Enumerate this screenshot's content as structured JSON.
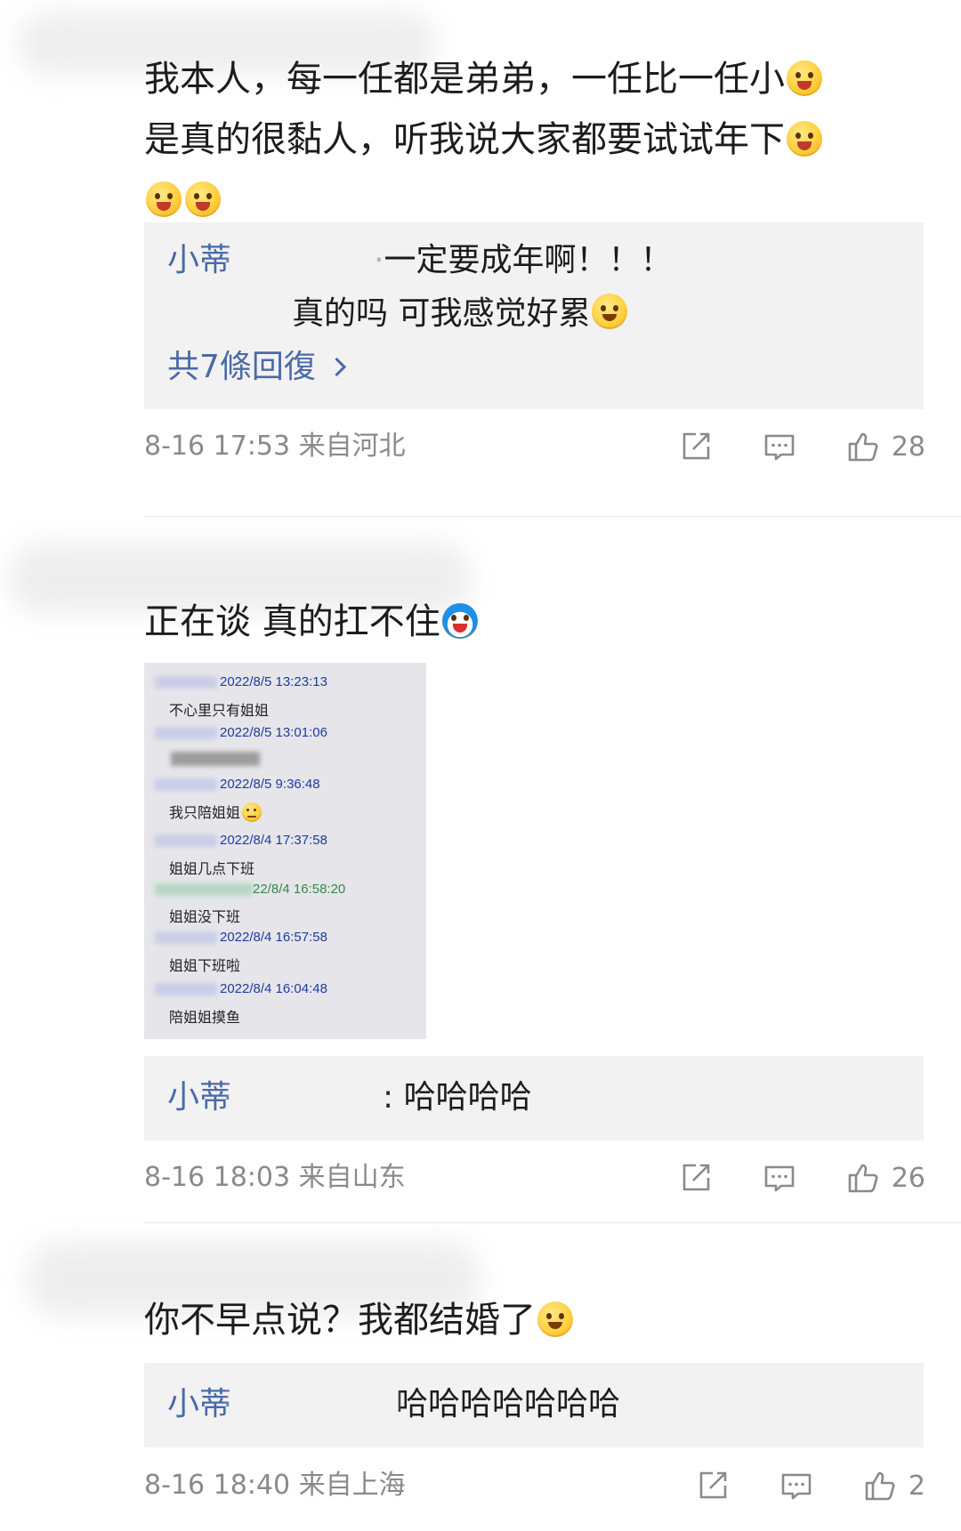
{
  "comments": [
    {
      "text_line1": "我本人，每一任都是弟弟，一任比一任小",
      "text_line2": "是真的很黏人，听我说大家都要试试年下",
      "replies": [
        {
          "author": "小蒂",
          "separator": "·",
          "text": "一定要成年啊！！！"
        },
        {
          "author": "",
          "text": "真的吗 可我感觉好累"
        }
      ],
      "more_replies": "共7條回復",
      "time": "8-16 17:53",
      "location": "来自河北",
      "likes": "28"
    },
    {
      "text": "正在谈 真的扛不住",
      "screenshot": {
        "messages": [
          {
            "time": "2022/8/5 13:23:13",
            "text": "不心里只有姐姐"
          },
          {
            "time": "2022/8/5 13:01:06",
            "text": ""
          },
          {
            "time": "2022/8/5 9:36:48",
            "text": "我只陪姐姐"
          },
          {
            "time": "2022/8/4 17:37:58",
            "text": "姐姐几点下班"
          },
          {
            "time": "22/8/4 16:58:20",
            "text": "姐姐没下班"
          },
          {
            "time": "2022/8/4 16:57:58",
            "text": "姐姐下班啦"
          },
          {
            "time": "2022/8/4 16:04:48",
            "text": "陪姐姐摸鱼"
          }
        ]
      },
      "replies": [
        {
          "author": "小蒂",
          "text": ": 哈哈哈哈"
        }
      ],
      "time": "8-16 18:03",
      "location": "来自山东",
      "likes": "26"
    },
    {
      "text": "你不早点说？我都结婚了",
      "replies": [
        {
          "author": "小蒂",
          "text": "哈哈哈哈哈哈哈"
        }
      ],
      "time": "8-16 18:40",
      "location": "来自上海",
      "likes": "2"
    }
  ]
}
